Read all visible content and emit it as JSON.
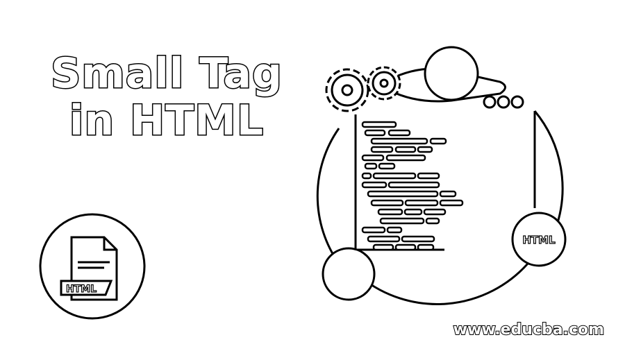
{
  "title": {
    "line1": "Small Tag",
    "line2": "in HTML"
  },
  "illustration": {
    "file_badge_label": "HTML",
    "bubble_badge_label": "HTML",
    "icons": [
      "html-file-icon",
      "gear-icon",
      "gear-icon",
      "code-editor-window",
      "window-dots-icon"
    ]
  },
  "footer": {
    "website": "www.educba.com"
  },
  "colors": {
    "background": "#ffffff",
    "outline": "#000000"
  }
}
